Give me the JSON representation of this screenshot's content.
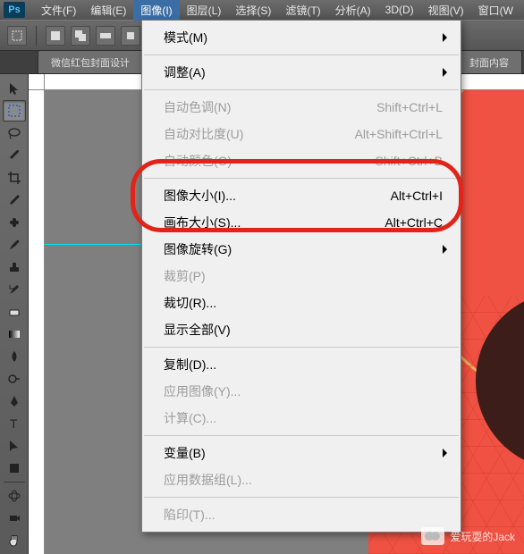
{
  "logo": "Ps",
  "menubar": [
    {
      "label": "文件(F)"
    },
    {
      "label": "编辑(E)"
    },
    {
      "label": "图像(I)",
      "active": true
    },
    {
      "label": "图层(L)"
    },
    {
      "label": "选择(S)"
    },
    {
      "label": "滤镜(T)"
    },
    {
      "label": "分析(A)"
    },
    {
      "label": "3D(D)"
    },
    {
      "label": "视图(V)"
    },
    {
      "label": "窗口(W"
    }
  ],
  "tab_left": "微信红包封面设计",
  "tab_right": "封面内容",
  "dropdown": {
    "groups": [
      [
        {
          "label": "模式(M)",
          "sub": true
        }
      ],
      [
        {
          "label": "调整(A)",
          "sub": true
        }
      ],
      [
        {
          "label": "自动色调(N)",
          "shortcut": "Shift+Ctrl+L",
          "disabled": true
        },
        {
          "label": "自动对比度(U)",
          "shortcut": "Alt+Shift+Ctrl+L",
          "disabled": true
        },
        {
          "label": "自动颜色(O)",
          "shortcut": "Shift+Ctrl+B",
          "disabled": true
        }
      ],
      [
        {
          "label": "图像大小(I)...",
          "shortcut": "Alt+Ctrl+I"
        },
        {
          "label": "画布大小(S)...",
          "shortcut": "Alt+Ctrl+C"
        },
        {
          "label": "图像旋转(G)",
          "sub": true
        },
        {
          "label": "裁剪(P)",
          "disabled": true
        },
        {
          "label": "裁切(R)..."
        },
        {
          "label": "显示全部(V)"
        }
      ],
      [
        {
          "label": "复制(D)..."
        },
        {
          "label": "应用图像(Y)...",
          "disabled": true
        },
        {
          "label": "计算(C)...",
          "disabled": true
        }
      ],
      [
        {
          "label": "变量(B)",
          "sub": true
        },
        {
          "label": "应用数据组(L)...",
          "disabled": true
        }
      ],
      [
        {
          "label": "陷印(T)...",
          "disabled": true
        }
      ]
    ]
  },
  "watermark": "爱玩耍的Jack"
}
